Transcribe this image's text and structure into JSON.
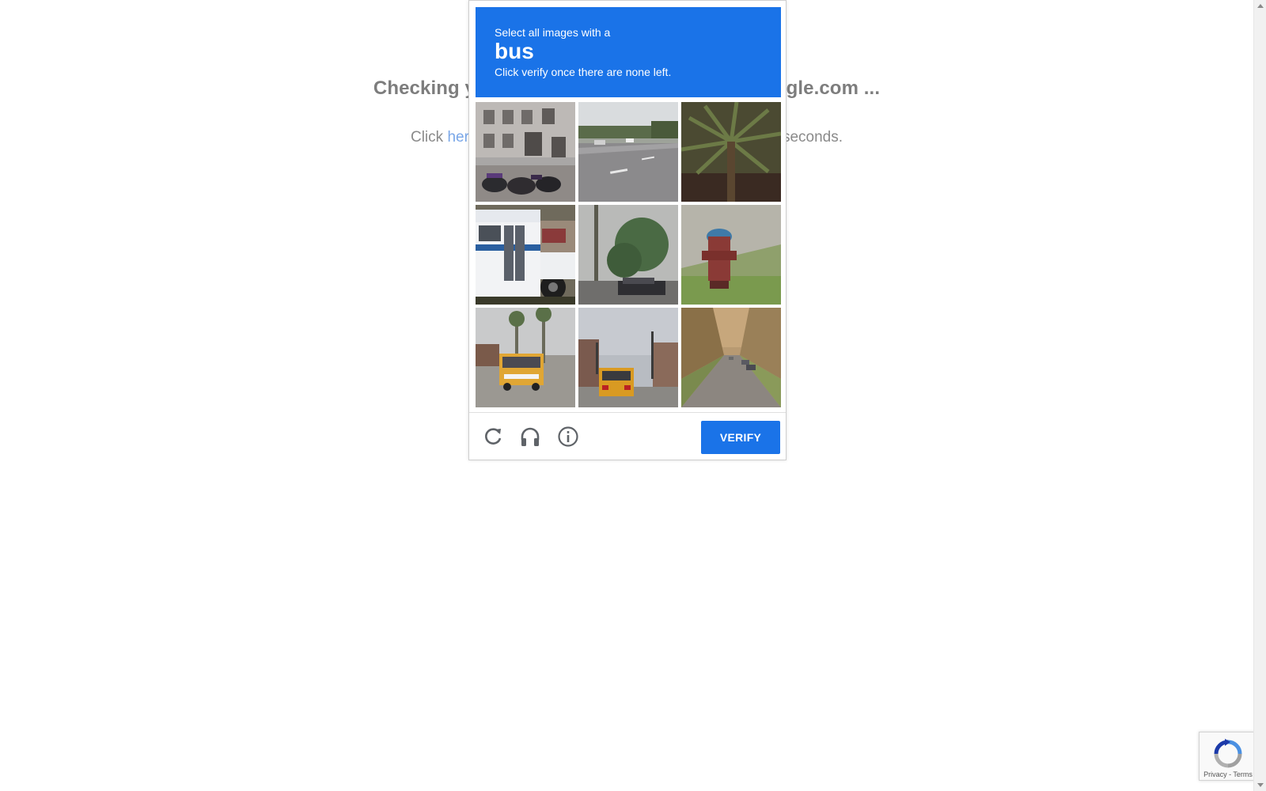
{
  "background": {
    "title": "Checking your browser before accessing kaggle.com ...",
    "subtitle_prefix": "Click ",
    "subtitle_link": "here",
    "subtitle_suffix": " if you are not automatically redirected after 5 seconds."
  },
  "challenge": {
    "prompt": {
      "line1": "Select all images with a",
      "keyword": "bus",
      "line2": "Click verify once there are none left."
    },
    "tiles": [
      {
        "depicts": "building with parked motorcycles",
        "selected": false
      },
      {
        "depicts": "road with cars",
        "selected": false
      },
      {
        "depicts": "palm tree",
        "selected": false
      },
      {
        "depicts": "white bus",
        "selected": false
      },
      {
        "depicts": "trees and parked cars",
        "selected": false
      },
      {
        "depicts": "fire hydrant",
        "selected": false
      },
      {
        "depicts": "school bus on street with palms",
        "selected": false
      },
      {
        "depicts": "school bus at intersection",
        "selected": false
      },
      {
        "depicts": "tree-lined residential street",
        "selected": false
      }
    ],
    "footer": {
      "reload_icon": "reload-icon",
      "audio_icon": "headphones-icon",
      "info_icon": "info-icon",
      "verify_label": "VERIFY"
    }
  },
  "badge": {
    "links": "Privacy - Terms"
  },
  "colors": {
    "accent": "#1a73e8",
    "background_text": "#7d7d7d",
    "link": "#7aa7e8"
  }
}
